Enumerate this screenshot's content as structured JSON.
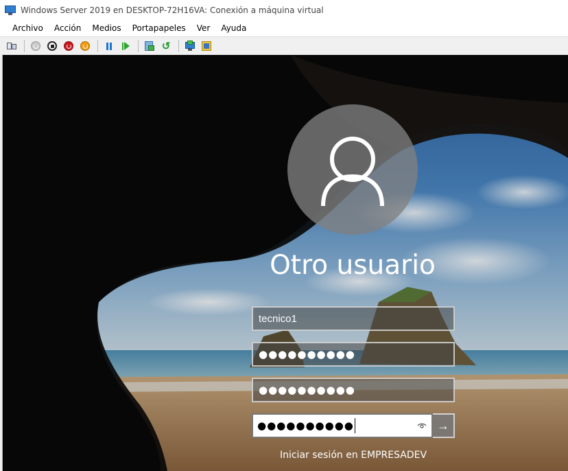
{
  "window": {
    "title": "Windows Server 2019 en DESKTOP-72H16VA: Conexión a máquina virtual"
  },
  "menu": {
    "items": [
      {
        "label": "Archivo"
      },
      {
        "label": "Acción"
      },
      {
        "label": "Medios"
      },
      {
        "label": "Portapapeles"
      },
      {
        "label": "Ver"
      },
      {
        "label": "Ayuda"
      }
    ]
  },
  "toolbar": {
    "icons": [
      "ctrl-alt-del-icon",
      "start-icon",
      "turn-off-icon",
      "shut-down-icon",
      "save-state-icon",
      "pause-icon",
      "resume-icon",
      "checkpoint-icon",
      "revert-icon",
      "enhanced-session-icon",
      "share-icon",
      "fit-window-icon"
    ]
  },
  "login": {
    "user_name": "Otro usuario",
    "username_value": "tecnico1",
    "password_mask_1": "●●●●●●●●●●",
    "password_mask_2": "●●●●●●●●●●",
    "password_mask_3": "●●●●●●●●●●",
    "submit_glyph": "→",
    "sign_in_to": "Iniciar sesión en EMPRESADEV"
  },
  "colors": {
    "accent": "#1a74d1",
    "field_border": "#dcdcdc",
    "sky": "#3d78b6",
    "sand": "#b48a5c"
  }
}
